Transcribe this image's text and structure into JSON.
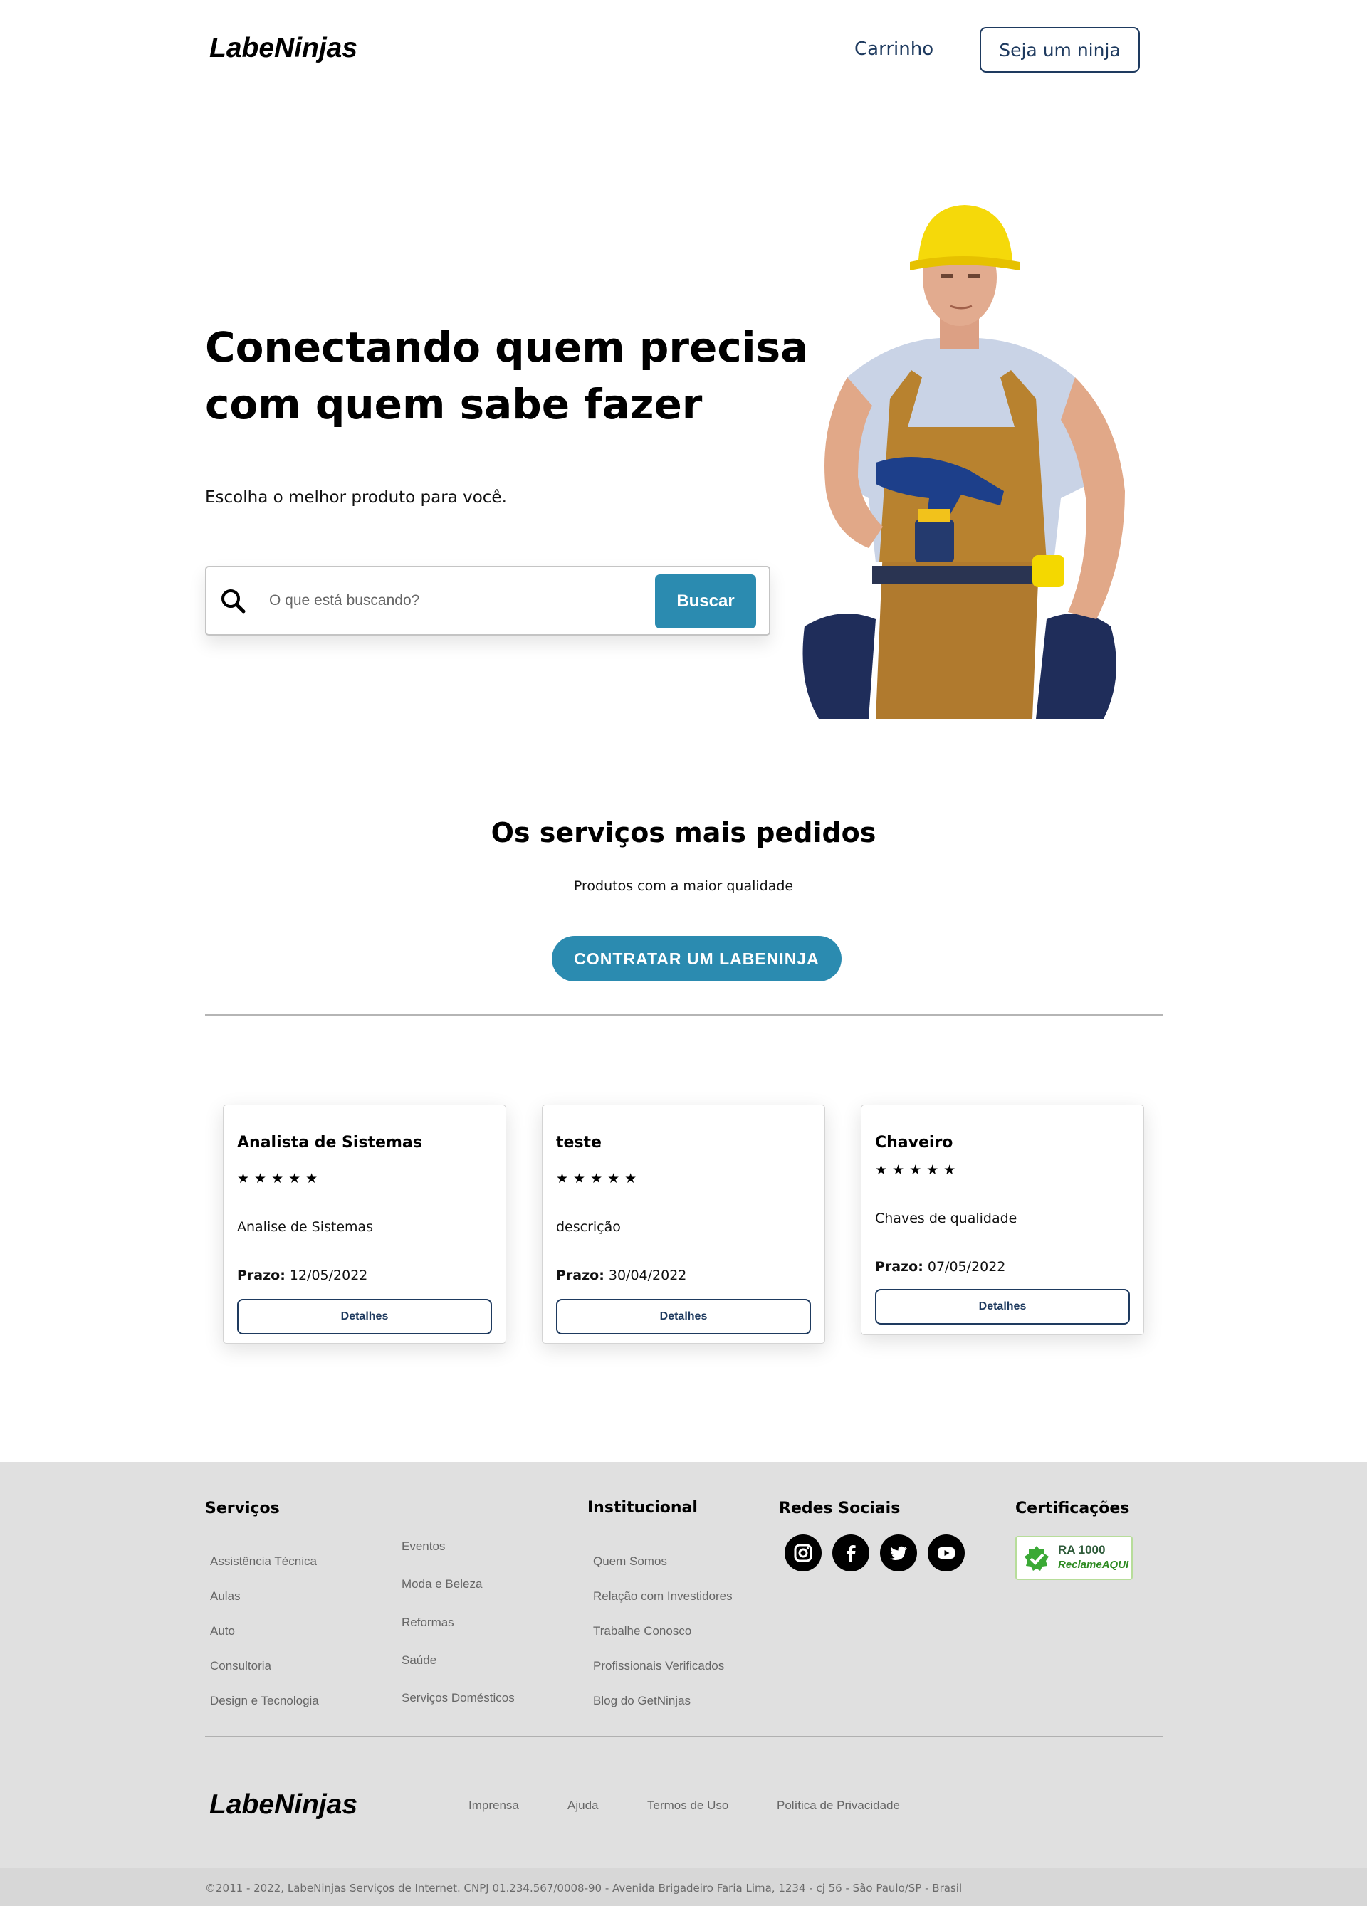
{
  "header": {
    "logo": "LabeNinjas",
    "cart_label": "Carrinho",
    "ninja_button": "Seja um ninja"
  },
  "hero": {
    "title_line1": "Conectando quem precisa",
    "title_line2": "com quem sabe fazer",
    "subtitle": "Escolha o melhor produto para você.",
    "search_placeholder": "O que está buscando?",
    "search_button": "Buscar"
  },
  "services": {
    "title": "Os serviços mais pedidos",
    "subtitle": "Produtos com a maior qualidade",
    "hire_button": "CONTRATAR UM LABENINJA"
  },
  "cards": [
    {
      "title": "Analista de Sistemas",
      "stars": "★★★★★",
      "description": "Analise de Sistemas",
      "deadline_label": "Prazo:",
      "deadline": "12/05/2022",
      "button": "Detalhes"
    },
    {
      "title": "teste",
      "stars": "★★★★★",
      "description": "descrição",
      "deadline_label": "Prazo:",
      "deadline": "30/04/2022",
      "button": "Detalhes"
    },
    {
      "title": "Chaveiro",
      "stars": "★★★★★",
      "description": "Chaves de qualidade",
      "deadline_label": "Prazo:",
      "deadline": "07/05/2022",
      "button": "Detalhes"
    }
  ],
  "footer": {
    "services_heading": "Serviços",
    "services_col1": [
      "Assistência Técnica",
      "Aulas",
      "Auto",
      "Consultoria",
      "Design e Tecnologia"
    ],
    "services_col2": [
      "Eventos",
      "Moda e Beleza",
      "Reformas",
      "Saúde",
      "Serviços Domésticos"
    ],
    "institutional_heading": "Institucional",
    "institutional": [
      "Quem Somos",
      "Relação com Investidores",
      "Trabalhe Conosco",
      "Profissionais Verificados",
      "Blog do GetNinjas"
    ],
    "social_heading": "Redes Sociais",
    "social_icons": [
      "instagram-icon",
      "facebook-icon",
      "twitter-icon",
      "youtube-icon"
    ],
    "cert_heading": "Certificações",
    "cert_badge_line1": "RA 1000",
    "cert_badge_line2": "ReclameAQUI",
    "logo": "LabeNinjas",
    "bottom_links": [
      "Imprensa",
      "Ajuda",
      "Termos de Uso",
      "Política de Privacidade"
    ],
    "copyright": "©2011 - 2022, LabeNinjas Serviços de Internet. CNPJ 01.234.567/0008-90 - Avenida Brigadeiro Faria Lima, 1234 - cj 56 - São Paulo/SP - Brasil"
  },
  "colors": {
    "accent": "#2b8bb0",
    "navy": "#1e3a5f",
    "footer_bg": "#e0e0e0"
  }
}
